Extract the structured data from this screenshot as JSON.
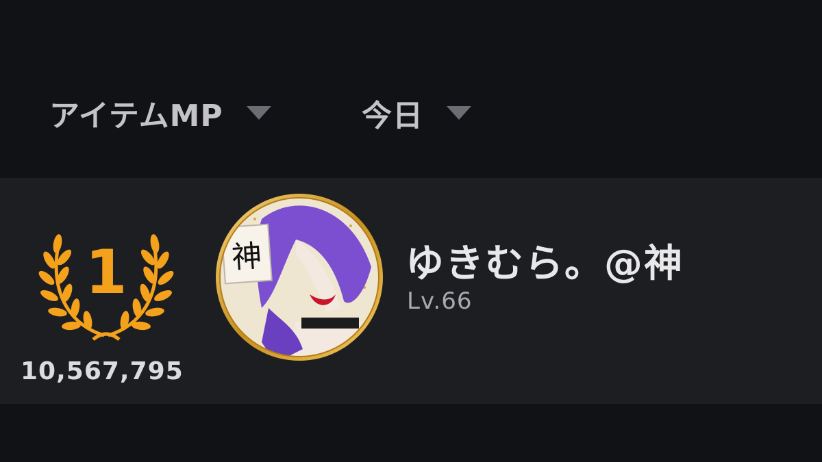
{
  "filters": {
    "category": {
      "label": "アイテムMP",
      "icon": "caret-down-icon"
    },
    "period": {
      "label": "今日",
      "icon": "caret-down-icon"
    }
  },
  "ranking": [
    {
      "rank": "1",
      "score": "10,567,795",
      "name": "ゆきむら。@神",
      "level": "Lv.66",
      "badge": "laurel-wreath-icon",
      "avatar_text": "神"
    }
  ],
  "colors": {
    "background": "#111216",
    "row_background": "#1d1e22",
    "gold": "#f4a11c",
    "avatar_hair": "#7b4fd0"
  }
}
